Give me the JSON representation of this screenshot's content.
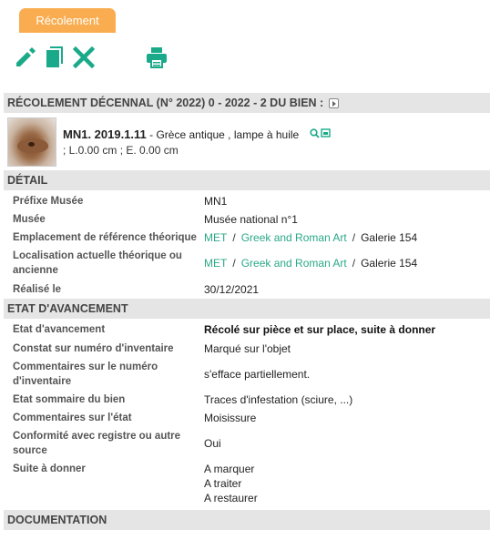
{
  "tab": {
    "label": "Récolement"
  },
  "toolbar": {
    "icons": [
      "pencil-icon",
      "copy-icon",
      "close-icon",
      "printer-icon"
    ],
    "accent_color": "#1aaa8a"
  },
  "header": {
    "title": "RÉCOLEMENT DÉCENNAL (N° 2022) 0 - 2022 - 2 DU BIEN :"
  },
  "item": {
    "inventory": "MN1. 2019.1.11",
    "description": "- Grèce antique , lampe à huile",
    "dimensions": "; L.0.00 cm ; E. 0.00 cm"
  },
  "detail": {
    "title": "DÉTAIL",
    "rows": [
      {
        "label": "Préfixe Musée",
        "value": "MN1"
      },
      {
        "label": "Musée",
        "value": "Musée national n°1"
      },
      {
        "label": "Emplacement de référence théorique",
        "link1": "MET",
        "link2": "Greek and Roman Art",
        "tail": "Galerie 154"
      },
      {
        "label": "Localisation actuelle théorique ou ancienne",
        "link1": "MET",
        "link2": "Greek and Roman Art",
        "tail": "Galerie 154"
      },
      {
        "label": "Réalisé le",
        "value": "30/12/2021"
      }
    ]
  },
  "progress": {
    "title": "ETAT D'AVANCEMENT",
    "rows": [
      {
        "label": "Etat d'avancement",
        "value": "Récolé sur pièce et sur place, suite à donner"
      },
      {
        "label": "Constat sur numéro d'inventaire",
        "value": "Marqué sur l'objet"
      },
      {
        "label": "Commentaires sur le numéro d'inventaire",
        "value": "s'efface partiellement."
      },
      {
        "label": "Etat sommaire du bien",
        "value": "Traces d'infestation (sciure, ...)"
      },
      {
        "label": "Commentaires sur l'état",
        "value": "Moisissure"
      },
      {
        "label": "Conformité avec registre ou autre source",
        "value": "Oui"
      },
      {
        "label": "Suite à donner",
        "values": [
          "A marquer",
          "A traiter",
          "A restaurer"
        ]
      }
    ]
  },
  "documentation": {
    "title": "DOCUMENTATION"
  },
  "separator": "/"
}
